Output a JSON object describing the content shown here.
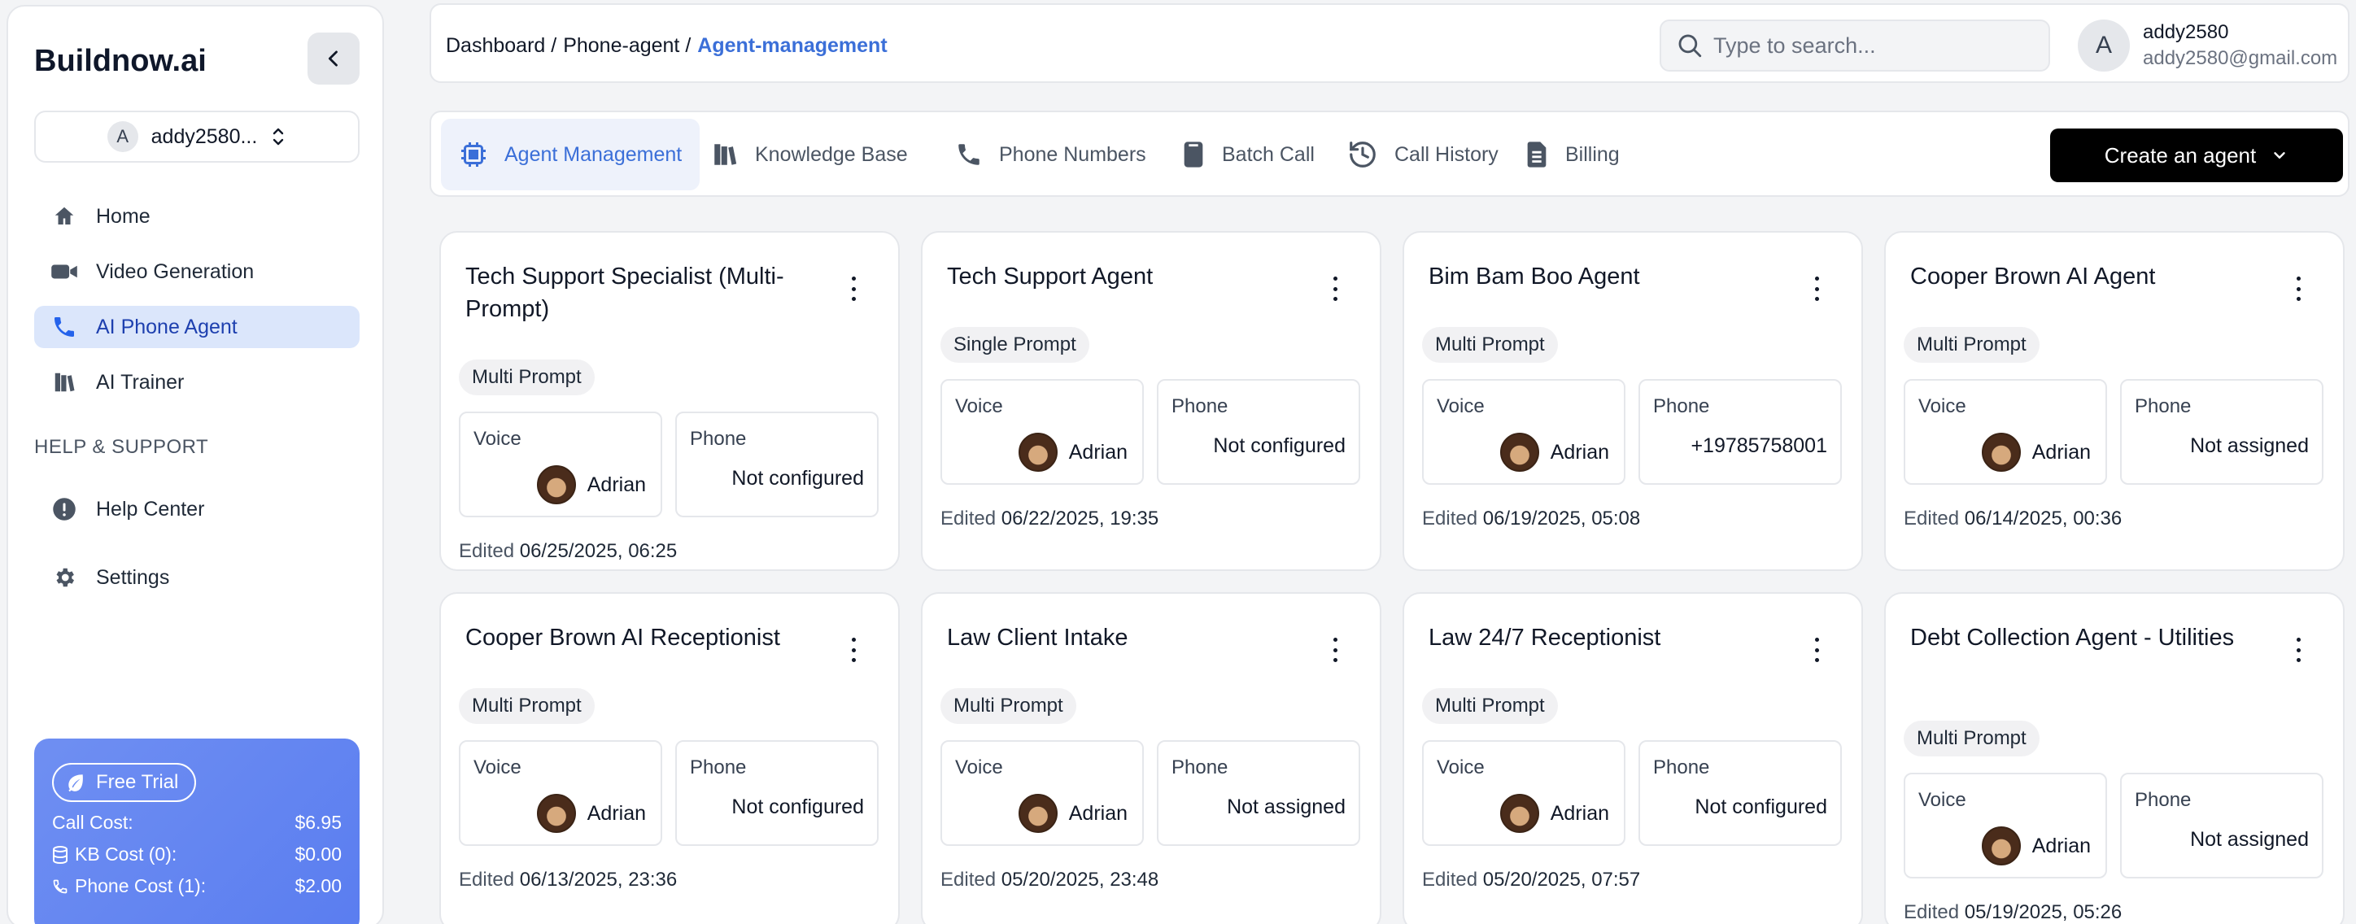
{
  "brand": "Buildnow.ai",
  "account": {
    "label": "addy2580...",
    "initial": "A"
  },
  "nav": [
    {
      "label": "Home",
      "icon": "home-icon"
    },
    {
      "label": "Video Generation",
      "icon": "video-camera-icon"
    },
    {
      "label": "AI Phone Agent",
      "icon": "phone-icon",
      "active": true
    },
    {
      "label": "AI Trainer",
      "icon": "books-icon"
    }
  ],
  "support": {
    "heading": "HELP & SUPPORT",
    "items": [
      {
        "label": "Help Center",
        "icon": "alert-circle-icon"
      },
      {
        "label": "Settings",
        "icon": "gear-icon"
      }
    ]
  },
  "trial": {
    "label": "Free Trial",
    "costs": [
      {
        "label": "Call Cost:",
        "value": "$6.95"
      },
      {
        "label": "KB Cost (0):",
        "value": "$0.00"
      },
      {
        "label": "Phone Cost (1):",
        "value": "$2.00"
      }
    ]
  },
  "breadcrumb": [
    "Dashboard /",
    "Phone-agent /",
    "Agent-management"
  ],
  "search": {
    "placeholder": "Type to search..."
  },
  "user": {
    "initial": "A",
    "name": "addy2580",
    "email": "addy2580@gmail.com"
  },
  "tabs": [
    {
      "label": "Agent Management",
      "icon": "cpu-icon",
      "active": true
    },
    {
      "label": "Knowledge Base",
      "icon": "books-icon"
    },
    {
      "label": "Phone Numbers",
      "icon": "phone-icon"
    },
    {
      "label": "Batch Call",
      "icon": "device-icon"
    },
    {
      "label": "Call History",
      "icon": "history-icon"
    },
    {
      "label": "Billing",
      "icon": "document-icon"
    }
  ],
  "create_button": "Create an agent",
  "field_labels": {
    "voice": "Voice",
    "phone": "Phone",
    "edited": "Edited"
  },
  "agents": [
    {
      "name": "Tech Support Specialist (Multi-Prompt)",
      "type": "Multi Prompt",
      "voice": "Adrian",
      "phone": "Not configured",
      "edited": "06/25/2025, 06:25"
    },
    {
      "name": "Tech Support Agent",
      "type": "Single Prompt",
      "voice": "Adrian",
      "phone": "Not configured",
      "edited": "06/22/2025, 19:35"
    },
    {
      "name": "Bim Bam Boo Agent",
      "type": "Multi Prompt",
      "voice": "Adrian",
      "phone": "+19785758001",
      "edited": "06/19/2025, 05:08"
    },
    {
      "name": "Cooper Brown AI Agent",
      "type": "Multi Prompt",
      "voice": "Adrian",
      "phone": "Not assigned",
      "edited": "06/14/2025, 00:36"
    },
    {
      "name": "Cooper Brown AI Receptionist",
      "type": "Multi Prompt",
      "voice": "Adrian",
      "phone": "Not configured",
      "edited": "06/13/2025, 23:36"
    },
    {
      "name": "Law Client Intake",
      "type": "Multi Prompt",
      "voice": "Adrian",
      "phone": "Not assigned",
      "edited": "05/20/2025, 23:48"
    },
    {
      "name": "Law 24/7 Receptionist",
      "type": "Multi Prompt",
      "voice": "Adrian",
      "phone": "Not configured",
      "edited": "05/20/2025, 07:57"
    },
    {
      "name": "Debt Collection Agent - Utilities",
      "type": "Multi Prompt",
      "voice": "Adrian",
      "phone": "Not assigned",
      "edited": "05/19/2025, 05:26"
    }
  ]
}
